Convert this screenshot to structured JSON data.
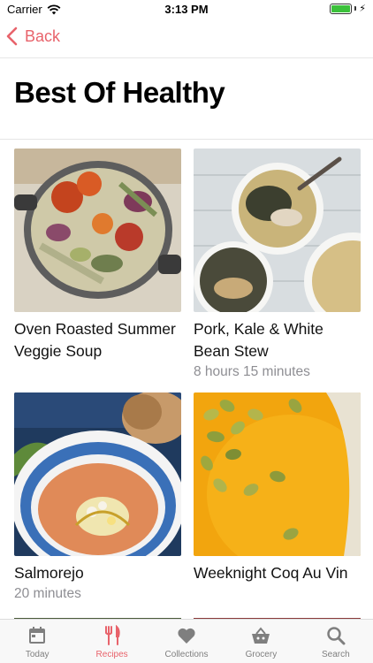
{
  "status_bar": {
    "carrier": "Carrier",
    "time": "3:13 PM"
  },
  "nav": {
    "back_label": "Back"
  },
  "page": {
    "title": "Best Of Healthy"
  },
  "recipes": [
    {
      "title": "Oven Roasted Summer Veggie Soup",
      "subtitle": ""
    },
    {
      "title": "Pork, Kale & White Bean Stew",
      "subtitle": "8 hours 15 minutes"
    },
    {
      "title": "Salmorejo",
      "subtitle": "20 minutes"
    },
    {
      "title": "Weeknight Coq Au Vin",
      "subtitle": ""
    }
  ],
  "tabs": [
    {
      "label": "Today",
      "icon": "calendar-icon"
    },
    {
      "label": "Recipes",
      "icon": "fork-knife-icon"
    },
    {
      "label": "Collections",
      "icon": "heart-icon"
    },
    {
      "label": "Grocery",
      "icon": "basket-icon"
    },
    {
      "label": "Search",
      "icon": "search-icon"
    }
  ],
  "colors": {
    "accent": "#e8636b",
    "inactive": "#7f7f7f"
  }
}
